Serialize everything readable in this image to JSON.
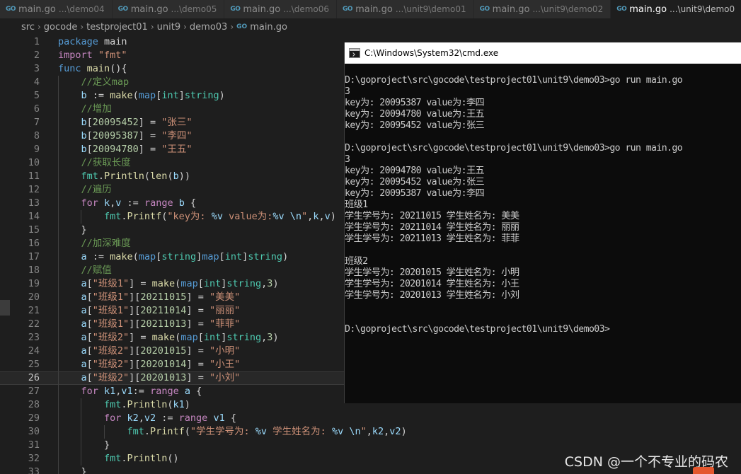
{
  "tabs": [
    {
      "name": "main.go",
      "path": "...\\demo04",
      "active": false
    },
    {
      "name": "main.go",
      "path": "...\\demo05",
      "active": false
    },
    {
      "name": "main.go",
      "path": "...\\demo06",
      "active": false
    },
    {
      "name": "main.go",
      "path": "...\\unit9\\demo01",
      "active": false
    },
    {
      "name": "main.go",
      "path": "...\\unit9\\demo02",
      "active": false
    },
    {
      "name": "main.go",
      "path": "...\\unit9\\demo0",
      "active": true
    }
  ],
  "tab_icon_text": "GO",
  "breadcrumb": [
    "src",
    "gocode",
    "testproject01",
    "unit9",
    "demo03",
    "main.go"
  ],
  "editor": {
    "current_line": 26,
    "lines": [
      {
        "n": "1",
        "indent": 0,
        "tokens": [
          [
            "k",
            "package"
          ],
          [
            "p",
            " main"
          ]
        ]
      },
      {
        "n": "2",
        "indent": 0,
        "tokens": [
          [
            "c",
            "import"
          ],
          [
            "p",
            " "
          ],
          [
            "s",
            "\"fmt\""
          ]
        ]
      },
      {
        "n": "3",
        "indent": 0,
        "tokens": [
          [
            "k",
            "func"
          ],
          [
            "p",
            " "
          ],
          [
            "f",
            "main"
          ],
          [
            "p",
            "(){"
          ]
        ]
      },
      {
        "n": "4",
        "indent": 1,
        "tokens": [
          [
            "cm",
            "//定义map"
          ]
        ]
      },
      {
        "n": "5",
        "indent": 1,
        "tokens": [
          [
            "v",
            "b"
          ],
          [
            "p",
            " := "
          ],
          [
            "f",
            "make"
          ],
          [
            "p",
            "("
          ],
          [
            "k",
            "map"
          ],
          [
            "p",
            "["
          ],
          [
            "t",
            "int"
          ],
          [
            "p",
            "]"
          ],
          [
            "t",
            "string"
          ],
          [
            "p",
            ")"
          ]
        ]
      },
      {
        "n": "6",
        "indent": 1,
        "tokens": [
          [
            "cm",
            "//增加"
          ]
        ]
      },
      {
        "n": "7",
        "indent": 1,
        "tokens": [
          [
            "v",
            "b"
          ],
          [
            "p",
            "["
          ],
          [
            "n",
            "20095452"
          ],
          [
            "p",
            "] = "
          ],
          [
            "s",
            "\"张三\""
          ]
        ]
      },
      {
        "n": "8",
        "indent": 1,
        "tokens": [
          [
            "v",
            "b"
          ],
          [
            "p",
            "["
          ],
          [
            "n",
            "20095387"
          ],
          [
            "p",
            "] = "
          ],
          [
            "s",
            "\"李四\""
          ]
        ]
      },
      {
        "n": "9",
        "indent": 1,
        "tokens": [
          [
            "v",
            "b"
          ],
          [
            "p",
            "["
          ],
          [
            "n",
            "20094780"
          ],
          [
            "p",
            "] = "
          ],
          [
            "s",
            "\"王五\""
          ]
        ]
      },
      {
        "n": "10",
        "indent": 1,
        "tokens": [
          [
            "cm",
            "//获取长度"
          ]
        ]
      },
      {
        "n": "11",
        "indent": 1,
        "tokens": [
          [
            "t",
            "fmt"
          ],
          [
            "p",
            "."
          ],
          [
            "f",
            "Println"
          ],
          [
            "p",
            "("
          ],
          [
            "f",
            "len"
          ],
          [
            "p",
            "("
          ],
          [
            "v",
            "b"
          ],
          [
            "p",
            "))"
          ]
        ]
      },
      {
        "n": "12",
        "indent": 1,
        "tokens": [
          [
            "cm",
            "//遍历"
          ]
        ]
      },
      {
        "n": "13",
        "indent": 1,
        "tokens": [
          [
            "c",
            "for"
          ],
          [
            "p",
            " "
          ],
          [
            "v",
            "k"
          ],
          [
            "p",
            ","
          ],
          [
            "v",
            "v"
          ],
          [
            "p",
            " := "
          ],
          [
            "c",
            "range"
          ],
          [
            "p",
            " "
          ],
          [
            "v",
            "b"
          ],
          [
            "p",
            " {"
          ]
        ]
      },
      {
        "n": "14",
        "indent": 2,
        "tokens": [
          [
            "t",
            "fmt"
          ],
          [
            "p",
            "."
          ],
          [
            "f",
            "Printf"
          ],
          [
            "p",
            "("
          ],
          [
            "s",
            "\"key为: "
          ],
          [
            "v",
            "%v"
          ],
          [
            "s",
            " value为:"
          ],
          [
            "v",
            "%v"
          ],
          [
            "s",
            " "
          ],
          [
            "v",
            "\\n"
          ],
          [
            "s",
            "\""
          ],
          [
            "p",
            ","
          ],
          [
            "v",
            "k"
          ],
          [
            "p",
            ","
          ],
          [
            "v",
            "v"
          ],
          [
            "p",
            ")"
          ]
        ]
      },
      {
        "n": "15",
        "indent": 1,
        "tokens": [
          [
            "p",
            "}"
          ]
        ]
      },
      {
        "n": "16",
        "indent": 1,
        "tokens": [
          [
            "cm",
            "//加深难度"
          ]
        ]
      },
      {
        "n": "17",
        "indent": 1,
        "tokens": [
          [
            "v",
            "a"
          ],
          [
            "p",
            " := "
          ],
          [
            "f",
            "make"
          ],
          [
            "p",
            "("
          ],
          [
            "k",
            "map"
          ],
          [
            "p",
            "["
          ],
          [
            "t",
            "string"
          ],
          [
            "p",
            "]"
          ],
          [
            "k",
            "map"
          ],
          [
            "p",
            "["
          ],
          [
            "t",
            "int"
          ],
          [
            "p",
            "]"
          ],
          [
            "t",
            "string"
          ],
          [
            "p",
            ")"
          ]
        ]
      },
      {
        "n": "18",
        "indent": 1,
        "tokens": [
          [
            "cm",
            "//赋值"
          ]
        ]
      },
      {
        "n": "19",
        "indent": 1,
        "tokens": [
          [
            "v",
            "a"
          ],
          [
            "p",
            "["
          ],
          [
            "s",
            "\"班级1\""
          ],
          [
            "p",
            "] = "
          ],
          [
            "f",
            "make"
          ],
          [
            "p",
            "("
          ],
          [
            "k",
            "map"
          ],
          [
            "p",
            "["
          ],
          [
            "t",
            "int"
          ],
          [
            "p",
            "]"
          ],
          [
            "t",
            "string"
          ],
          [
            "p",
            ","
          ],
          [
            "n",
            "3"
          ],
          [
            "p",
            ")"
          ]
        ]
      },
      {
        "n": "20",
        "indent": 1,
        "tokens": [
          [
            "v",
            "a"
          ],
          [
            "p",
            "["
          ],
          [
            "s",
            "\"班级1\""
          ],
          [
            "p",
            "]["
          ],
          [
            "n",
            "20211015"
          ],
          [
            "p",
            "] = "
          ],
          [
            "s",
            "\"美美\""
          ]
        ]
      },
      {
        "n": "21",
        "indent": 1,
        "tokens": [
          [
            "v",
            "a"
          ],
          [
            "p",
            "["
          ],
          [
            "s",
            "\"班级1\""
          ],
          [
            "p",
            "]["
          ],
          [
            "n",
            "20211014"
          ],
          [
            "p",
            "] = "
          ],
          [
            "s",
            "\"丽丽\""
          ]
        ]
      },
      {
        "n": "22",
        "indent": 1,
        "tokens": [
          [
            "v",
            "a"
          ],
          [
            "p",
            "["
          ],
          [
            "s",
            "\"班级1\""
          ],
          [
            "p",
            "]["
          ],
          [
            "n",
            "20211013"
          ],
          [
            "p",
            "] = "
          ],
          [
            "s",
            "\"菲菲\""
          ]
        ]
      },
      {
        "n": "23",
        "indent": 1,
        "tokens": [
          [
            "v",
            "a"
          ],
          [
            "p",
            "["
          ],
          [
            "s",
            "\"班级2\""
          ],
          [
            "p",
            "] = "
          ],
          [
            "f",
            "make"
          ],
          [
            "p",
            "("
          ],
          [
            "k",
            "map"
          ],
          [
            "p",
            "["
          ],
          [
            "t",
            "int"
          ],
          [
            "p",
            "]"
          ],
          [
            "t",
            "string"
          ],
          [
            "p",
            ","
          ],
          [
            "n",
            "3"
          ],
          [
            "p",
            ")"
          ]
        ]
      },
      {
        "n": "24",
        "indent": 1,
        "tokens": [
          [
            "v",
            "a"
          ],
          [
            "p",
            "["
          ],
          [
            "s",
            "\"班级2\""
          ],
          [
            "p",
            "]["
          ],
          [
            "n",
            "20201015"
          ],
          [
            "p",
            "] = "
          ],
          [
            "s",
            "\"小明\""
          ]
        ]
      },
      {
        "n": "25",
        "indent": 1,
        "tokens": [
          [
            "v",
            "a"
          ],
          [
            "p",
            "["
          ],
          [
            "s",
            "\"班级2\""
          ],
          [
            "p",
            "]["
          ],
          [
            "n",
            "20201014"
          ],
          [
            "p",
            "] = "
          ],
          [
            "s",
            "\"小王\""
          ]
        ]
      },
      {
        "n": "26",
        "indent": 1,
        "tokens": [
          [
            "v",
            "a"
          ],
          [
            "p",
            "["
          ],
          [
            "s",
            "\"班级2\""
          ],
          [
            "p",
            "]["
          ],
          [
            "n",
            "20201013"
          ],
          [
            "p",
            "] = "
          ],
          [
            "s",
            "\"小刘\""
          ]
        ]
      },
      {
        "n": "27",
        "indent": 1,
        "tokens": [
          [
            "c",
            "for"
          ],
          [
            "p",
            " "
          ],
          [
            "v",
            "k1"
          ],
          [
            "p",
            ","
          ],
          [
            "v",
            "v1"
          ],
          [
            "p",
            ":= "
          ],
          [
            "c",
            "range"
          ],
          [
            "p",
            " "
          ],
          [
            "v",
            "a"
          ],
          [
            "p",
            " {"
          ]
        ]
      },
      {
        "n": "28",
        "indent": 2,
        "tokens": [
          [
            "t",
            "fmt"
          ],
          [
            "p",
            "."
          ],
          [
            "f",
            "Println"
          ],
          [
            "p",
            "("
          ],
          [
            "v",
            "k1"
          ],
          [
            "p",
            ")"
          ]
        ]
      },
      {
        "n": "29",
        "indent": 2,
        "tokens": [
          [
            "c",
            "for"
          ],
          [
            "p",
            " "
          ],
          [
            "v",
            "k2"
          ],
          [
            "p",
            ","
          ],
          [
            "v",
            "v2"
          ],
          [
            "p",
            " := "
          ],
          [
            "c",
            "range"
          ],
          [
            "p",
            " "
          ],
          [
            "v",
            "v1"
          ],
          [
            "p",
            " {"
          ]
        ]
      },
      {
        "n": "30",
        "indent": 3,
        "tokens": [
          [
            "t",
            "fmt"
          ],
          [
            "p",
            "."
          ],
          [
            "f",
            "Printf"
          ],
          [
            "p",
            "("
          ],
          [
            "s",
            "\"学生学号为: "
          ],
          [
            "v",
            "%v"
          ],
          [
            "s",
            " 学生姓名为: "
          ],
          [
            "v",
            "%v"
          ],
          [
            "s",
            " "
          ],
          [
            "v",
            "\\n"
          ],
          [
            "s",
            "\""
          ],
          [
            "p",
            ","
          ],
          [
            "v",
            "k2"
          ],
          [
            "p",
            ","
          ],
          [
            "v",
            "v2"
          ],
          [
            "p",
            ")"
          ]
        ]
      },
      {
        "n": "31",
        "indent": 2,
        "tokens": [
          [
            "p",
            "}"
          ]
        ]
      },
      {
        "n": "32",
        "indent": 2,
        "tokens": [
          [
            "t",
            "fmt"
          ],
          [
            "p",
            "."
          ],
          [
            "f",
            "Println"
          ],
          [
            "p",
            "()"
          ]
        ]
      },
      {
        "n": "33",
        "indent": 1,
        "tokens": [
          [
            "p",
            "}"
          ]
        ]
      }
    ]
  },
  "cmd": {
    "title": "C:\\Windows\\System32\\cmd.exe",
    "lines": [
      "D:\\goproject\\src\\gocode\\testproject01\\unit9\\demo03>go run main.go",
      "3",
      "key为: 20095387 value为:李四",
      "key为: 20094780 value为:王五",
      "key为: 20095452 value为:张三",
      "",
      "D:\\goproject\\src\\gocode\\testproject01\\unit9\\demo03>go run main.go",
      "3",
      "key为: 20094780 value为:王五",
      "key为: 20095452 value为:张三",
      "key为: 20095387 value为:李四",
      "班级1",
      "学生学号为: 20211015 学生姓名为: 美美",
      "学生学号为: 20211014 学生姓名为: 丽丽",
      "学生学号为: 20211013 学生姓名为: 菲菲",
      "",
      "班级2",
      "学生学号为: 20201015 学生姓名为: 小明",
      "学生学号为: 20201014 学生姓名为: 小王",
      "学生学号为: 20201013 学生姓名为: 小刘",
      "",
      "",
      "D:\\goproject\\src\\gocode\\testproject01\\unit9\\demo03>"
    ]
  },
  "watermark": "CSDN @一个不专业的码农"
}
